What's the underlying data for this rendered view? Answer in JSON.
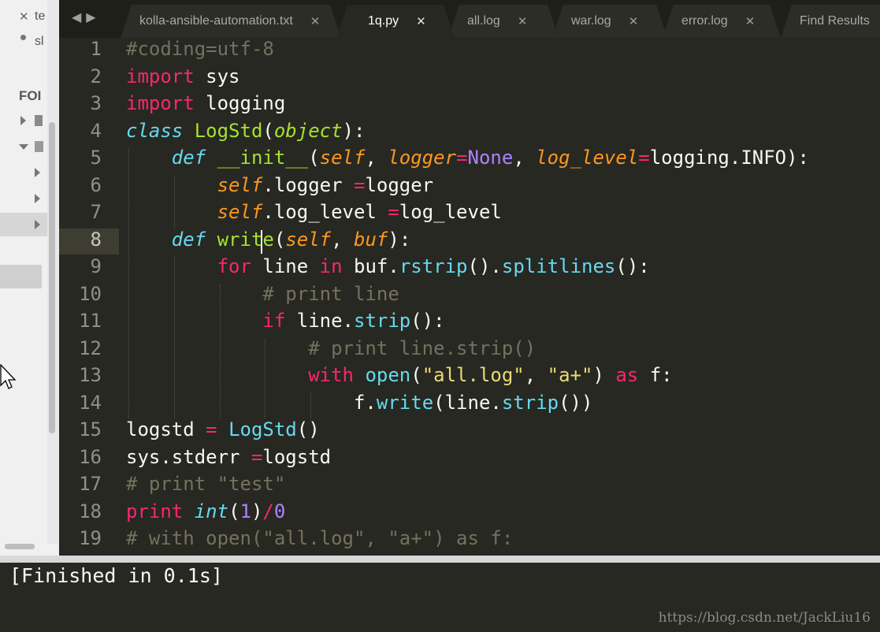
{
  "sidebar": {
    "open_files": [
      "te",
      "sl"
    ],
    "folders_header": "FOI"
  },
  "tabs": [
    {
      "label": "kolla-ansible-automation.txt",
      "active": false
    },
    {
      "label": "1q.py",
      "active": true
    },
    {
      "label": "all.log",
      "active": false
    },
    {
      "label": "war.log",
      "active": false
    },
    {
      "label": "error.log",
      "active": false
    },
    {
      "label": "Find Results",
      "active": false
    }
  ],
  "close_glyph": "✕",
  "nav_arrows": "◀▶",
  "editor": {
    "current_line": 8,
    "line_numbers": [
      "1",
      "2",
      "3",
      "4",
      "5",
      "6",
      "7",
      "8",
      "9",
      "10",
      "11",
      "12",
      "13",
      "14",
      "15",
      "16",
      "17",
      "18",
      "19"
    ],
    "lines": [
      [
        [
          "cm",
          "#coding=utf-8"
        ]
      ],
      [
        [
          "kw",
          "import"
        ],
        [
          "",
          "sys"
        ]
      ],
      [
        [
          "kw",
          "import"
        ],
        [
          "",
          "logging"
        ]
      ],
      [
        [
          "st",
          "class"
        ],
        [
          "",
          ""
        ],
        [
          "fn",
          "LogStd"
        ],
        [
          "",
          "("
        ],
        [
          "it",
          "object"
        ],
        [
          "",
          "):"
        ]
      ],
      [
        [
          "",
          "    "
        ],
        [
          "st",
          "def"
        ],
        [
          "",
          ""
        ],
        [
          "fn",
          "__init__"
        ],
        [
          "",
          "("
        ],
        [
          "pa",
          "self"
        ],
        [
          "",
          ", "
        ],
        [
          "pa",
          "logger"
        ],
        [
          "kw",
          "="
        ],
        [
          "nu",
          "None"
        ],
        [
          "",
          ", "
        ],
        [
          "pa",
          "log_level"
        ],
        [
          "kw",
          "="
        ],
        [
          "",
          "logging.INFO):"
        ]
      ],
      [
        [
          "",
          "        "
        ],
        [
          "pa",
          "self"
        ],
        [
          "",
          ".logger "
        ],
        [
          "kw",
          "="
        ],
        [
          "",
          "logger"
        ]
      ],
      [
        [
          "",
          "        "
        ],
        [
          "pa",
          "self"
        ],
        [
          "",
          ".log_level "
        ],
        [
          "kw",
          "="
        ],
        [
          "",
          "log_level"
        ]
      ],
      [
        [
          "",
          "    "
        ],
        [
          "st",
          "def"
        ],
        [
          "",
          ""
        ],
        [
          "fn",
          "write"
        ],
        [
          "",
          "("
        ],
        [
          "pa",
          "self"
        ],
        [
          "",
          ", "
        ],
        [
          "pa",
          "buf"
        ],
        [
          "",
          "):"
        ]
      ],
      [
        [
          "",
          "        "
        ],
        [
          "kw",
          "for"
        ],
        [
          "",
          "line "
        ],
        [
          "kw",
          "in"
        ],
        [
          "",
          "buf."
        ],
        [
          "bi",
          "rstrip"
        ],
        [
          "",
          "()."
        ],
        [
          "bi",
          "splitlines"
        ],
        [
          "",
          "():"
        ]
      ],
      [
        [
          "",
          "            "
        ],
        [
          "cm",
          "# print line"
        ]
      ],
      [
        [
          "",
          "            "
        ],
        [
          "kw",
          "if"
        ],
        [
          "",
          "line."
        ],
        [
          "bi",
          "strip"
        ],
        [
          "",
          "():"
        ]
      ],
      [
        [
          "",
          "                "
        ],
        [
          "cm",
          "# print line.strip()"
        ]
      ],
      [
        [
          "",
          "                "
        ],
        [
          "kw",
          "with"
        ],
        [
          "",
          ""
        ],
        [
          "bi",
          "open"
        ],
        [
          "",
          "("
        ],
        [
          "sr",
          "\"all.log\""
        ],
        [
          "",
          ", "
        ],
        [
          "sr",
          "\"a+\""
        ],
        [
          "",
          ") "
        ],
        [
          "kw",
          "as"
        ],
        [
          "",
          "f:"
        ]
      ],
      [
        [
          "",
          "                    "
        ],
        [
          "",
          "f."
        ],
        [
          "bi",
          "write"
        ],
        [
          "",
          "(line."
        ],
        [
          "bi",
          "strip"
        ],
        [
          "",
          "())"
        ]
      ],
      [
        [
          "",
          "logstd "
        ],
        [
          "kw",
          "="
        ],
        [
          "",
          ""
        ],
        [
          "bi",
          "LogStd"
        ],
        [
          "",
          "()"
        ]
      ],
      [
        [
          "",
          "sys.stderr "
        ],
        [
          "kw",
          "="
        ],
        [
          "",
          "logstd"
        ]
      ],
      [
        [
          "cm",
          "# print \"test\""
        ]
      ],
      [
        [
          "kw",
          "print"
        ],
        [
          "",
          ""
        ],
        [
          "st",
          "int"
        ],
        [
          "",
          "("
        ],
        [
          "nu",
          "1"
        ],
        [
          "",
          ")"
        ],
        [
          "kw",
          "/"
        ],
        [
          "nu",
          "0"
        ]
      ],
      [
        [
          "cm",
          "# with open(\"all.log\", \"a+\") as f:"
        ]
      ]
    ]
  },
  "output": {
    "text": "[Finished in 0.1s]"
  },
  "watermark": "https://blog.csdn.net/JackLiu16",
  "colors": {
    "background": "#272822",
    "keyword": "#f92672",
    "storage": "#66d9ef",
    "function": "#a6e22e",
    "parameter": "#fd971f",
    "comment": "#75715e",
    "number": "#ae81ff",
    "string": "#e6db74"
  }
}
